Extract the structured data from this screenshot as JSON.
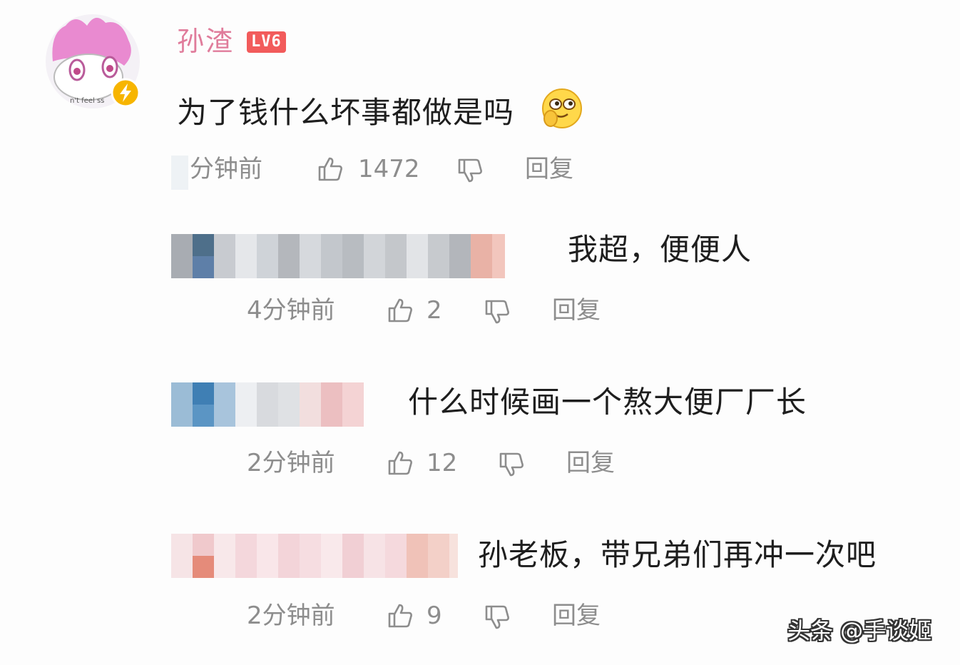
{
  "main_comment": {
    "username": "孙渣",
    "level": "LV6",
    "text": "为了钱什么坏事都做是吗",
    "time": "分钟前",
    "likes": "1472",
    "reply_label": "回复"
  },
  "replies": [
    {
      "text": "我超，便便人",
      "time": "4分钟前",
      "likes": "2",
      "reply_label": "回复"
    },
    {
      "text": "什么时候画一个熬大便厂厂长",
      "time": "2分钟前",
      "likes": "12",
      "reply_label": "回复"
    },
    {
      "text": "孙老板，带兄弟们再冲一次吧",
      "time": "2分钟前",
      "likes": "9",
      "reply_label": "回复"
    }
  ],
  "watermark": "头条 @手谈姬",
  "colors": {
    "username": "#e07c9b",
    "level_badge": "#f25b5b",
    "meta_text": "#8d8d8d",
    "body_text": "#1e1e1e"
  },
  "icons": {
    "like": "thumbs-up-icon",
    "dislike": "thumbs-down-icon",
    "badge": "lightning-badge-icon",
    "emoji": "smirk-emoji-icon"
  }
}
